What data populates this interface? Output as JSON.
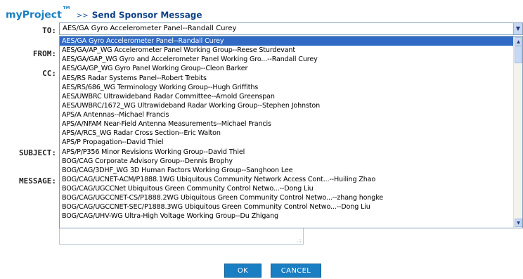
{
  "header": {
    "brand": "myProject",
    "trademark": "™",
    "separator": ">>",
    "title": "Send Sponsor Message"
  },
  "form": {
    "to_label": "TO:",
    "from_label": "FROM:",
    "cc_label": "CC:",
    "subject_label": "SUBJECT:",
    "message_label": "MESSAGE:",
    "to_selected": "AES/GA Gyro Accelerometer Panel--Randall Curey"
  },
  "dropdown_options": [
    "AES/GA Gyro Accelerometer Panel--Randall Curey",
    "AES/GA/AP_WG Accelerometer Panel Working Group--Reese Sturdevant",
    "AES/GA/GAP_WG Gyro and Accelerometer Panel Working Gro...--Randall Curey",
    "AES/GA/GP_WG Gyro Panel Working Group--Cleon Barker",
    "AES/RS Radar Systems Panel--Robert Trebits",
    "AES/RS/686_WG Terminology Working Group--Hugh Griffiths",
    "AES/UWBRC Ultrawideband Radar Committee--Arnold Greenspan",
    "AES/UWBRC/1672_WG Ultrawideband Radar Working Group--Stephen Johnston",
    "APS/A Antennas--Michael Francis",
    "APS/A/NFAM Near-Field Antenna Measurements--Michael Francis",
    "APS/A/RCS_WG Radar Cross Section--Eric Walton",
    "APS/P Propagation--David Thiel",
    "APS/P/P356 Minor Revisions Working Group--David Thiel",
    "BOG/CAG Corporate Advisory Group--Dennis Brophy",
    "BOG/CAG/3DHF_WG 3D Human Factors Working Group--Sanghoon Lee",
    "BOG/CAG/UCNET-ACM/P1888.1WG Ubiquitous Community Network Access Cont...--Huiling Zhao",
    "BOG/CAG/UGCCNet Ubiquitous Green Community Control Netwo...--Dong Liu",
    "BOG/CAG/UGCCNET-CS/P1888.2WG Ubiquitous Green Community Control Netwo...--zhang hongke",
    "BOG/CAG/UGCCNET-SEC/P1888.3WG Ubiquitous Green Community Control Netwo...--Dong Liu",
    "BOG/CAG/UHV-WG Ultra-High Voltage Working Group--Du Zhigang"
  ],
  "buttons": {
    "ok": "OK",
    "cancel": "CANCEL"
  },
  "icons": {
    "dropdown_arrow": "chevron-down-icon",
    "scroll_up": "arrow-up-icon",
    "scroll_down": "arrow-down-icon",
    "resize_grip": "resize-grip-icon"
  },
  "colors": {
    "brand": "#1a7fc0",
    "title": "#0b3f86",
    "selection": "#316ac5",
    "button": "#1a7ec2"
  }
}
